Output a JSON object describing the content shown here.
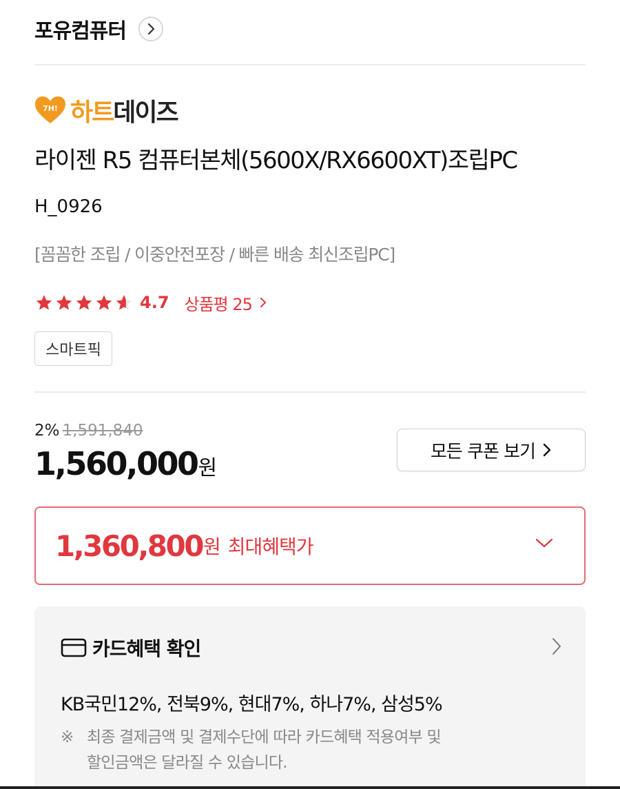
{
  "seller": {
    "name": "포유컴퓨터",
    "chevron_icon": "chevron-right-icon"
  },
  "brand": {
    "logo_icon": "heart-icon",
    "logo_icon_text": "7H!",
    "name_part1": "하트",
    "name_part2": "데이즈"
  },
  "product": {
    "title": "라이젠 R5 컴퓨터본체(5600X/RX6600XT)조립PC",
    "code": "H_0926",
    "tagline": "[꼼꼼한 조립 / 이중안전포장 / 빠른 배송 최신조립PC]"
  },
  "rating": {
    "stars": 4.7,
    "value": "4.7",
    "review_label": "상품평 25"
  },
  "badge": {
    "label": "스마트픽"
  },
  "price": {
    "discount_rate": "2%",
    "original": "1,591,840",
    "current": "1,560,000",
    "unit": "원",
    "coupon_button": "모든 쿠폰 보기"
  },
  "max_benefit": {
    "amount": "1,360,800",
    "unit": "원",
    "label": "최대혜택가"
  },
  "card_benefit": {
    "title": "카드혜택 확인",
    "rates": "KB국민12%, 전북9%, 현대7%, 하나7%, 삼성5%",
    "note_mark": "※",
    "note_line1": "최종 결제금액 및 결제수단에 따라 카드혜택 적용여부 및",
    "note_line2": "할인금액은 달라질 수 있습니다."
  },
  "colors": {
    "accent_red": "#e0383f",
    "brand_orange": "#f29a1f",
    "muted_gray": "#888888"
  }
}
